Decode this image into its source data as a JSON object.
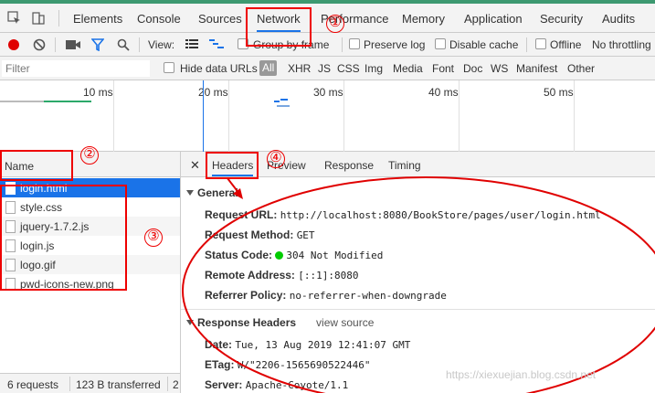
{
  "toolbar_tabs": [
    "Elements",
    "Console",
    "Sources",
    "Network",
    "Performance",
    "Memory",
    "Application",
    "Security",
    "Audits"
  ],
  "network_toolbar": {
    "view_label": "View:",
    "group_by_frame": "Group by frame",
    "preserve_log": "Preserve log",
    "disable_cache": "Disable cache",
    "offline": "Offline",
    "throttling": "No throttling"
  },
  "filter": {
    "placeholder": "Filter",
    "hide_data_urls": "Hide data URLs",
    "types": [
      "All",
      "XHR",
      "JS",
      "CSS",
      "Img",
      "Media",
      "Font",
      "Doc",
      "WS",
      "Manifest",
      "Other"
    ]
  },
  "timeline": {
    "ticks": [
      "10 ms",
      "20 ms",
      "30 ms",
      "40 ms",
      "50 ms"
    ]
  },
  "requests": {
    "column_name": "Name",
    "items": [
      "login.html",
      "style.css",
      "jquery-1.7.2.js",
      "login.js",
      "logo.gif",
      "pwd-icons-new.png"
    ]
  },
  "status": {
    "requests": "6 requests",
    "transferred": "123 B transferred",
    "extra": "2"
  },
  "detail": {
    "tabs": [
      "Headers",
      "Preview",
      "Response",
      "Timing"
    ],
    "general_title": "General",
    "general": [
      {
        "key": "Request URL:",
        "value": "http://localhost:8080/BookStore/pages/user/login.html"
      },
      {
        "key": "Request Method:",
        "value": "GET"
      },
      {
        "key": "Status Code:",
        "value": "304 Not Modified"
      },
      {
        "key": "Remote Address:",
        "value": "[::1]:8080"
      },
      {
        "key": "Referrer Policy:",
        "value": "no-referrer-when-downgrade"
      }
    ],
    "response_title": "Response Headers",
    "view_source": "view source",
    "response": [
      {
        "key": "Date:",
        "value": "Tue, 13 Aug 2019 12:41:07 GMT"
      },
      {
        "key": "ETag:",
        "value": "W/\"2206-1565690522446\""
      },
      {
        "key": "Server:",
        "value": "Apache-Coyote/1.1"
      }
    ]
  },
  "annotations": [
    "①",
    "②",
    "③",
    "④"
  ],
  "watermark": "https://xiexuejian.blog.csdn.net",
  "colors": {
    "accent": "#1a73e8",
    "annotation": "#e00000",
    "status_ok": "#00cc00",
    "record": "#e00000"
  }
}
